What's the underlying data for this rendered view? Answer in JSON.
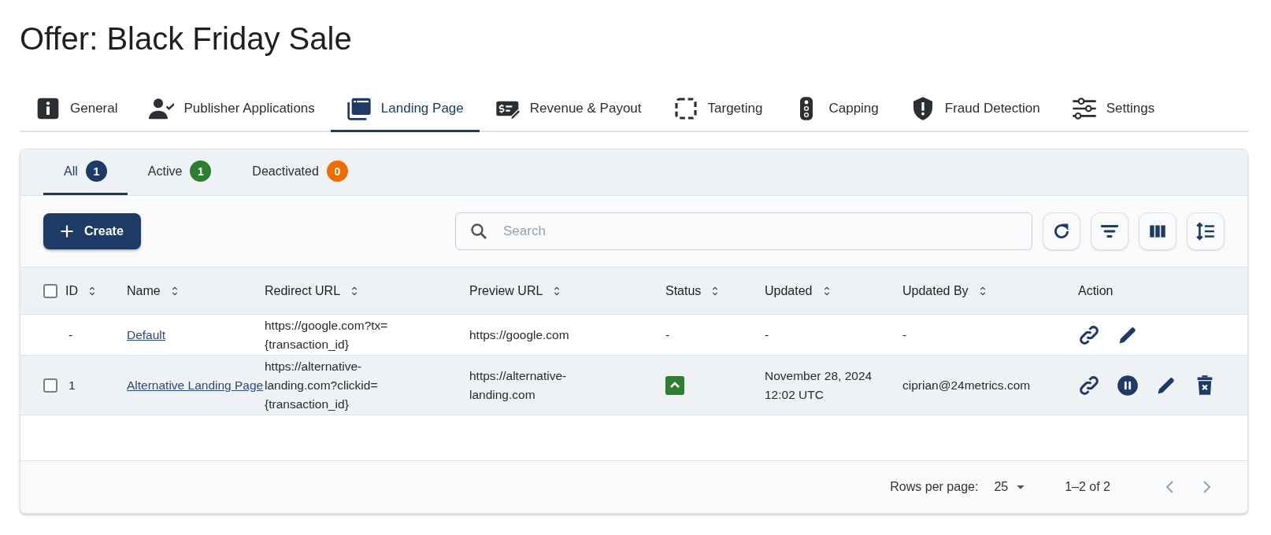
{
  "page": {
    "title": "Offer: Black Friday Sale"
  },
  "tabs": [
    {
      "label": "General",
      "kind": "info",
      "selected": false
    },
    {
      "label": "Publisher Applications",
      "kind": "user-check",
      "selected": false
    },
    {
      "label": "Landing Page",
      "kind": "window",
      "selected": true
    },
    {
      "label": "Revenue & Payout",
      "kind": "money",
      "selected": false
    },
    {
      "label": "Targeting",
      "kind": "dashed",
      "selected": false
    },
    {
      "label": "Capping",
      "kind": "light",
      "selected": false
    },
    {
      "label": "Fraud Detection",
      "kind": "shield",
      "selected": false
    },
    {
      "label": "Settings",
      "kind": "sliders",
      "selected": false
    }
  ],
  "subtabs": [
    {
      "label": "All",
      "count": "1",
      "color": "#1e3a66",
      "selected": true
    },
    {
      "label": "Active",
      "count": "1",
      "color": "#2e7d32",
      "selected": false
    },
    {
      "label": "Deactivated",
      "count": "0",
      "color": "#ef6c00",
      "selected": false
    }
  ],
  "toolbar": {
    "create_label": "Create",
    "search": {
      "placeholder": "Search"
    },
    "buttons": [
      {
        "kind": "refresh"
      },
      {
        "kind": "filter"
      },
      {
        "kind": "columns"
      },
      {
        "kind": "density"
      }
    ]
  },
  "table": {
    "select_all": {
      "checked": false
    },
    "columns": [
      {
        "label": "ID",
        "sortable": true
      },
      {
        "label": "Name",
        "sortable": true
      },
      {
        "label": "Redirect URL",
        "sortable": true
      },
      {
        "label": "Preview URL",
        "sortable": true
      },
      {
        "label": "Status",
        "sortable": true
      },
      {
        "label": "Updated",
        "sortable": true
      },
      {
        "label": "Updated By",
        "sortable": true
      },
      {
        "label": "Action",
        "sortable": false
      }
    ],
    "rows": [
      {
        "highlighted": false,
        "id": "-",
        "name": "Default",
        "redirect_url": [
          "https://google.com?tx=",
          "{transaction_id}"
        ],
        "preview_url": [
          "https://google.com"
        ],
        "status": {
          "kind": "text",
          "text": "-"
        },
        "updated": [
          "-"
        ],
        "updated_by": "-",
        "actions": [
          {
            "kind": "link"
          },
          {
            "kind": "edit"
          }
        ]
      },
      {
        "highlighted": true,
        "checkbox": {
          "checked": false
        },
        "id": "1",
        "name": "Alternative Landing Page",
        "redirect_url": [
          "https://alternative-",
          "landing.com?clickid=",
          "{transaction_id}"
        ],
        "preview_url": [
          "https://alternative-",
          "landing.com"
        ],
        "status": {
          "kind": "active"
        },
        "updated": [
          "November 28, 2024",
          "12:02 UTC"
        ],
        "updated_by": "ciprian@24metrics.com",
        "actions": [
          {
            "kind": "link"
          },
          {
            "kind": "pause"
          },
          {
            "kind": "edit"
          },
          {
            "kind": "delete"
          }
        ]
      }
    ]
  },
  "pagination": {
    "rows_per_page_label": "Rows per page:",
    "rows_per_page": "25",
    "range": "1–2 of 2"
  }
}
